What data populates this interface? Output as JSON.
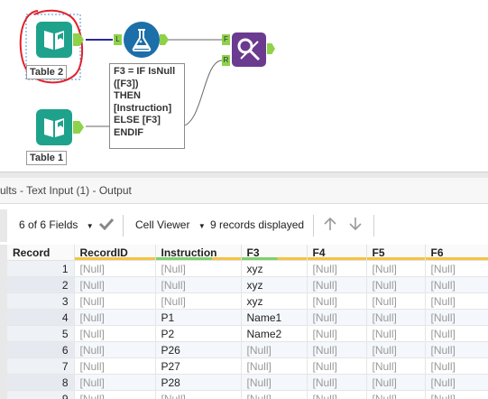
{
  "canvas": {
    "tools": {
      "table2_label": "Table 2",
      "table1_label": "Table 1",
      "formula_lines": [
        "F3 = IF IsNull",
        "([F3])",
        "THEN",
        "[Instruction]",
        "ELSE [F3]",
        "ENDIF"
      ],
      "anchor_l": "L",
      "anchor_f": "F",
      "anchor_r": "R"
    },
    "colors": {
      "input_tool": "#1ea28c",
      "formula_tool": "#1c6fa8",
      "find_replace_tool": "#6a3b8f",
      "annotation_red": "#e3202a"
    }
  },
  "results": {
    "title": "ults - Text Input (1) - Output"
  },
  "toolbar": {
    "fields_label": "6 of 6 Fields",
    "cell_viewer_label": "Cell Viewer",
    "records_label": "9 records displayed"
  },
  "grid": {
    "columns": [
      "Record",
      "RecordID",
      "Instruction",
      "F3",
      "F4",
      "F5",
      "F6"
    ],
    "rows": [
      [
        "1",
        "[Null]",
        "[Null]",
        "xyz",
        "[Null]",
        "[Null]",
        "[Null]"
      ],
      [
        "2",
        "[Null]",
        "[Null]",
        "xyz",
        "[Null]",
        "[Null]",
        "[Null]"
      ],
      [
        "3",
        "[Null]",
        "[Null]",
        "xyz",
        "[Null]",
        "[Null]",
        "[Null]"
      ],
      [
        "4",
        "[Null]",
        "P1",
        "Name1",
        "[Null]",
        "[Null]",
        "[Null]"
      ],
      [
        "5",
        "[Null]",
        "P2",
        "Name2",
        "[Null]",
        "[Null]",
        "[Null]"
      ],
      [
        "6",
        "[Null]",
        "P26",
        "[Null]",
        "[Null]",
        "[Null]",
        "[Null]"
      ],
      [
        "7",
        "[Null]",
        "P27",
        "[Null]",
        "[Null]",
        "[Null]",
        "[Null]"
      ],
      [
        "8",
        "[Null]",
        "P28",
        "[Null]",
        "[Null]",
        "[Null]",
        "[Null]"
      ],
      [
        "9",
        "[Null]",
        "[Null]",
        "[Null]",
        "[Null]",
        "[Null]",
        "[Null]"
      ]
    ]
  }
}
